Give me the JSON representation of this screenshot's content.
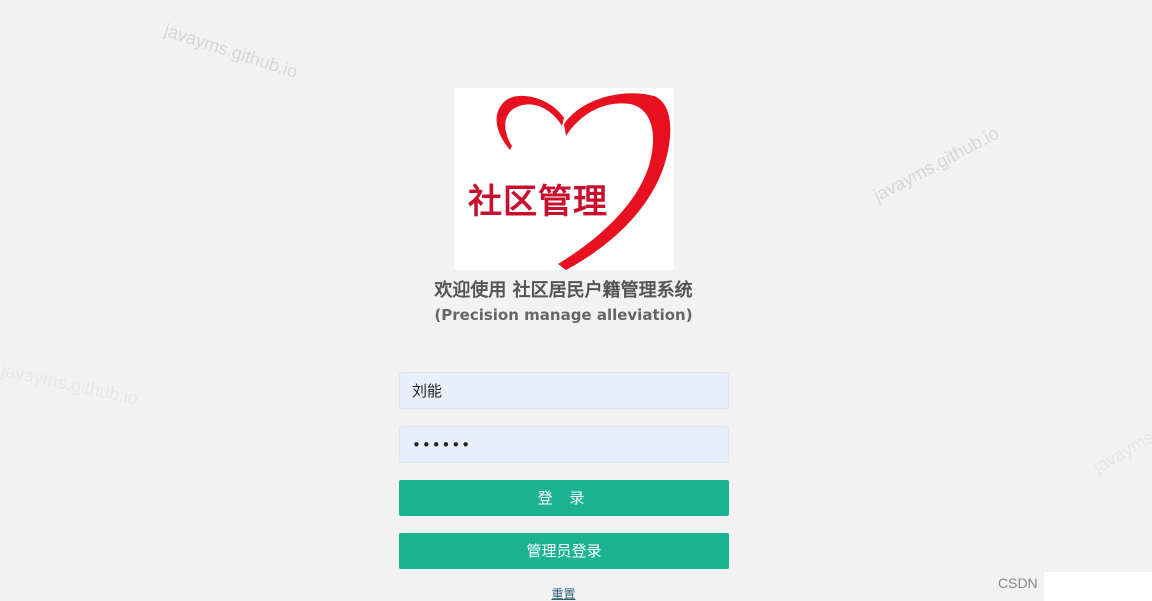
{
  "watermarks": [
    "javayms.github.io",
    "javayms.github.io",
    "javayms.github.io",
    "javayms.github.io"
  ],
  "logo": {
    "text": "社区管理",
    "heart_color": "#e8101e",
    "text_color": "#c8102e"
  },
  "header": {
    "title": "欢迎使用 社区居民户籍管理系统",
    "subtitle": "(Precision manage alleviation)"
  },
  "form": {
    "username_value": "刘能",
    "password_value": "••••••",
    "login_label": "登 录",
    "admin_login_label": "管理员登录",
    "reset_label": "重置"
  },
  "footer": {
    "badge": "CSDN"
  },
  "colors": {
    "accent": "#1bb394",
    "background": "#f2f2f2",
    "input_bg": "#e8eefb"
  }
}
